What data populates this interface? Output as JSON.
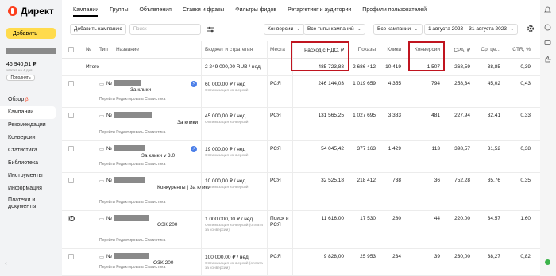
{
  "app": {
    "logo": "Директ",
    "add_button": "Добавить",
    "balance": "46 940,51 ₽",
    "balance_sub": "хватит на 4 дня",
    "topup": "Пополнить"
  },
  "nav": [
    {
      "label": "Обзор",
      "badge": "β"
    },
    {
      "label": "Кампании"
    },
    {
      "label": "Рекомендации"
    },
    {
      "label": "Конверсии"
    },
    {
      "label": "Статистика"
    },
    {
      "label": "Библиотека"
    },
    {
      "label": "Инструменты"
    },
    {
      "label": "Информация"
    },
    {
      "label": "Платежи и документы"
    }
  ],
  "tabs": [
    "Кампании",
    "Группы",
    "Объявления",
    "Ставки и фразы",
    "Фильтры фидов",
    "Ретаргетинг и аудитории",
    "Профили пользователей"
  ],
  "toolbar": {
    "add_campaign": "Добавить кампанию",
    "search_placeholder": "Поиск",
    "conv": "Конверсии",
    "campaign_types": "Все типы кампаний",
    "all_campaigns": "Все кампании",
    "date_range": "1 августа 2023 – 31 августа 2023"
  },
  "columns": {
    "num": "№",
    "type": "Тип",
    "name": "Название",
    "budget": "Бюджет и стратегия",
    "places": "Места",
    "spend": "Расход с НДС, ₽",
    "shows": "Показы",
    "clicks": "Клики",
    "conversions": "Конверсии",
    "cpa": "CPA, ₽",
    "avg": "Ср. це...",
    "ctr": "CTR, %"
  },
  "total": {
    "label": "Итого",
    "budget": "2 249 000,00 RUB / нед",
    "spend": "485 723,88",
    "shows": "2 686 412",
    "clicks": "10 419",
    "conversions": "1 507",
    "cpa": "268,59",
    "avg": "38,85",
    "ctr": "0,39"
  },
  "row_links": "Перейти   Редактировать   Статистика",
  "rows": [
    {
      "num": "№",
      "name_tail": "За клики",
      "budget": "60 000,00 ₽ / нед",
      "budget_sub": "Оптимизация конверсий",
      "places": "РСЯ",
      "spend": "246 144,03",
      "shows": "1 019 659",
      "clicks": "4 355",
      "conversions": "794",
      "cpa": "258,34",
      "avg": "45,02",
      "ctr": "0,43",
      "badge": "⚡"
    },
    {
      "num": "№",
      "name_tail": "За клики",
      "budget": "45 000,00 ₽ / нед",
      "budget_sub": "Оптимизация конверсий",
      "places": "РСЯ",
      "spend": "131 565,25",
      "shows": "1 027 695",
      "clicks": "3 383",
      "conversions": "481",
      "cpa": "227,94",
      "avg": "32,41",
      "ctr": "0,33"
    },
    {
      "num": "№",
      "name_tail": "За клики v 3.0",
      "budget": "19 000,00 ₽ / нед",
      "budget_sub": "Оптимизация конверсий",
      "places": "РСЯ",
      "spend": "54 045,42",
      "shows": "377 163",
      "clicks": "1 429",
      "conversions": "113",
      "cpa": "398,57",
      "avg": "31,52",
      "ctr": "0,38",
      "badge": "⚡"
    },
    {
      "num": "№",
      "name_tail": "Конкуренты | За клики",
      "budget": "10 000,00 ₽ / нед",
      "budget_sub": "Оптимизация конверсий",
      "places": "РСЯ",
      "spend": "32 525,18",
      "shows": "218 412",
      "clicks": "738",
      "conversions": "36",
      "cpa": "752,28",
      "avg": "35,76",
      "ctr": "0,35"
    },
    {
      "num": "№",
      "name_tail": "ОЗК 200",
      "budget": "1 000 000,00 ₽ / нед",
      "budget_sub": "Оптимизация конверсий (оплата за конверсии)",
      "places": "Поиск и РСЯ",
      "spend": "11 616,00",
      "shows": "17 530",
      "clicks": "280",
      "conversions": "44",
      "cpa": "220,00",
      "avg": "34,57",
      "ctr": "1,60"
    },
    {
      "num": "№",
      "name_tail": "ОЗК 200",
      "budget": "100 000,00 ₽ / нед",
      "budget_sub": "Оптимизация конверсий (оплата за конверсии)",
      "places": "РСЯ",
      "spend": "9 828,00",
      "shows": "25 953",
      "clicks": "234",
      "conversions": "39",
      "cpa": "230,00",
      "avg": "38,27",
      "ctr": "0,82"
    }
  ]
}
